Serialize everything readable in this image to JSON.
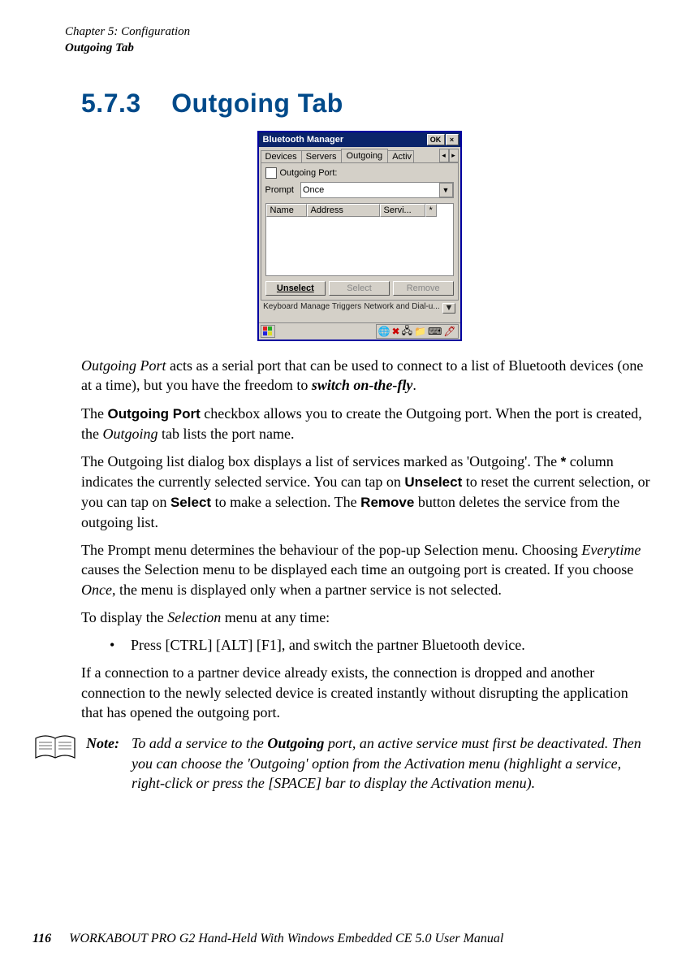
{
  "running_head": {
    "chapter": "Chapter 5: Configuration",
    "section": "Outgoing Tab"
  },
  "heading": {
    "number": "5.7.3",
    "title": "Outgoing Tab"
  },
  "screenshot": {
    "title": "Bluetooth Manager",
    "ok_button": "OK",
    "close_button": "×",
    "tabs": {
      "devices": "Devices",
      "servers": "Servers",
      "outgoing": "Outgoing",
      "active_partial": "Activ"
    },
    "outgoing_port_checkbox_label": "Outgoing Port:",
    "prompt_label": "Prompt",
    "prompt_value": "Once",
    "list_headers": {
      "name": "Name",
      "address": "Address",
      "service": "Servi...",
      "star": "*"
    },
    "buttons": {
      "unselect": "Unselect",
      "select": "Select",
      "remove": "Remove"
    },
    "bg_labels": {
      "keyboard": "Keyboard",
      "manage": "Manage Triggers",
      "network": "Network and Dial-u..."
    },
    "scrollbar_down": "▼"
  },
  "paragraphs": {
    "p1_a": "Outgoing Port",
    "p1_b": " acts as a serial port that can be used to connect to a list of Bluetooth devices (one at a time), but you have the freedom to ",
    "p1_c": "switch on-the-fly",
    "p1_d": ".",
    "p2_a": "The ",
    "p2_b": "Outgoing Port",
    "p2_c": " checkbox allows you to create the Outgoing port. When the port is created, the ",
    "p2_d": "Outgoing",
    "p2_e": " tab lists the port name.",
    "p3_a": "The Outgoing list dialog box displays a list of services marked as 'Outgoing'. The ",
    "p3_b": "*",
    "p3_c": " column indicates the currently selected service. You can tap on ",
    "p3_d": "Unselect",
    "p3_e": " to reset the current selection, or you can tap on ",
    "p3_f": "Select",
    "p3_g": " to make a selection. The ",
    "p3_h": "Remove",
    "p3_i": " button deletes the service from the outgoing list.",
    "p4_a": "The Prompt menu determines the behaviour of the pop-up Selection menu. Choosing ",
    "p4_b": "Everytime",
    "p4_c": " causes the Selection menu to be displayed each time an outgoing port is created. If you choose ",
    "p4_d": "Once",
    "p4_e": ", the menu is displayed only when a partner service is not selected.",
    "p5_a": "To display the ",
    "p5_b": "Selection",
    "p5_c": " menu at any time:",
    "bullet": "Press [CTRL] [ALT] [F1], and switch the partner Bluetooth device.",
    "p6": "If a connection to a partner device already exists, the connection is dropped and another connection to the newly selected device is created instantly without disrupting the application that has opened the outgoing port."
  },
  "note": {
    "label": "Note:",
    "text_a": "To add a service to the ",
    "text_b": "Outgoing",
    "text_c": " port, an active service must first be deactivated. Then you can choose the 'Outgoing' option from the Activation menu (highlight a service, right-click or press the [SPACE] bar to display the Activation menu)."
  },
  "footer": {
    "page": "116",
    "title": "WORKABOUT PRO G2 Hand-Held With Windows Embedded CE 5.0 User Manual"
  }
}
